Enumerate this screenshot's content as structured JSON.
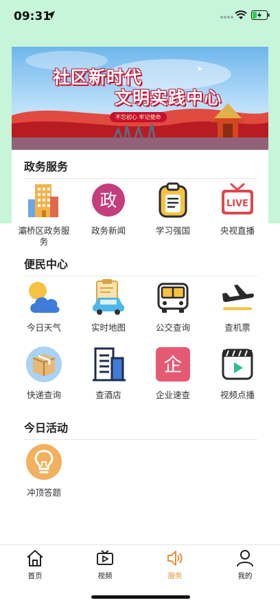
{
  "status_bar": {
    "time": "09:31"
  },
  "banner": {
    "title_line1": "社区新时代",
    "title_line2": "文明实践中心",
    "slogan": "不忘初心  牢记使命"
  },
  "sections": {
    "gov": {
      "title": "政务服务",
      "items": [
        {
          "label": "灞桥区政务服务",
          "icon": "building-icon"
        },
        {
          "label": "政务新闻",
          "icon": "zheng-badge-icon",
          "glyph": "政"
        },
        {
          "label": "学习强国",
          "icon": "clipboard-icon"
        },
        {
          "label": "央视直播",
          "icon": "live-tv-icon",
          "glyph": "LIVE"
        }
      ]
    },
    "convenience": {
      "title": "便民中心",
      "items": [
        {
          "label": "今日天气",
          "icon": "weather-icon"
        },
        {
          "label": "实时地图",
          "icon": "map-car-icon"
        },
        {
          "label": "公交查询",
          "icon": "bus-icon"
        },
        {
          "label": "查机票",
          "icon": "airplane-icon"
        },
        {
          "label": "快递查询",
          "icon": "package-icon"
        },
        {
          "label": "查酒店",
          "icon": "hotel-icon"
        },
        {
          "label": "企业速查",
          "icon": "enterprise-icon",
          "glyph": "企"
        },
        {
          "label": "视频点播",
          "icon": "video-play-icon"
        }
      ]
    },
    "activity": {
      "title": "今日活动",
      "items": [
        {
          "label": "冲顶答题",
          "icon": "lightbulb-icon"
        }
      ]
    }
  },
  "tabbar": {
    "items": [
      {
        "label": "首页",
        "icon": "home-icon"
      },
      {
        "label": "视频",
        "icon": "tv-icon"
      },
      {
        "label": "服务",
        "icon": "speaker-icon",
        "active": true
      },
      {
        "label": "我的",
        "icon": "user-icon"
      }
    ]
  },
  "colors": {
    "mint_background": "#c6f5d9",
    "active_tab": "#e8903a",
    "banner_red": "#c8102e"
  }
}
